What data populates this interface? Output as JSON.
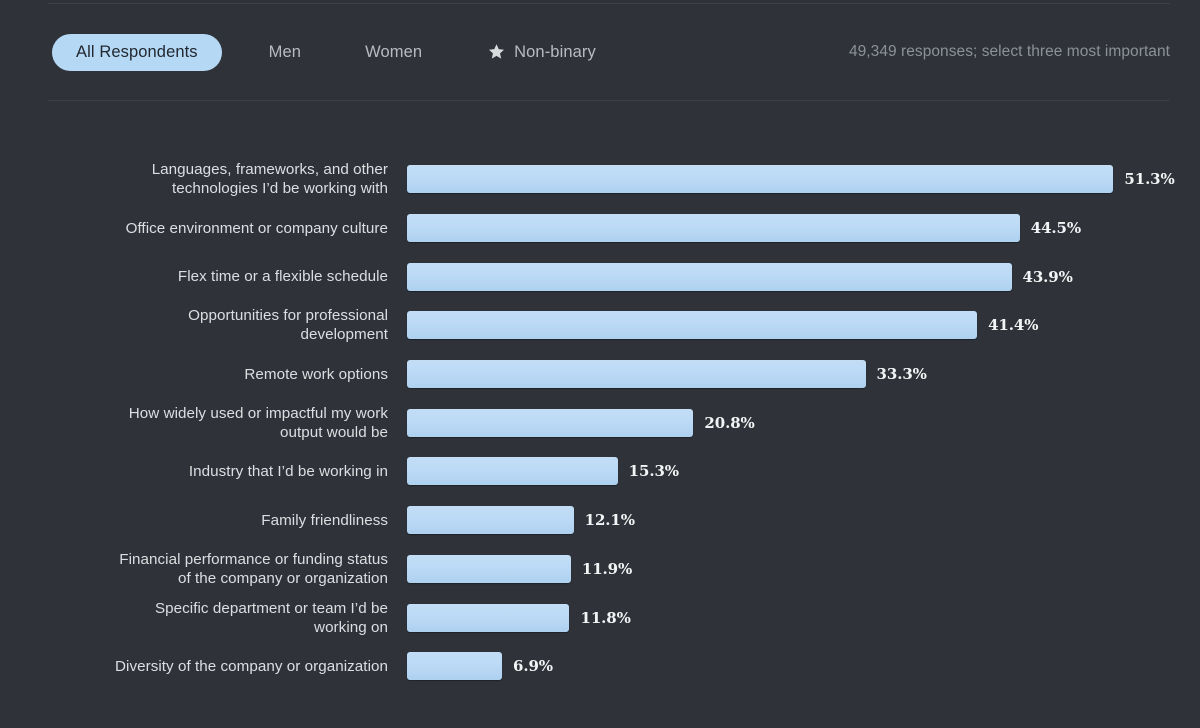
{
  "theme": {
    "background": "#2f3339",
    "bar_color": "#bcdaf6",
    "accent": "#b5d9f4",
    "label_color": "#dcdee1",
    "muted_color": "#8c9198",
    "rule_color": "#3a3f46"
  },
  "header": {
    "tabs": [
      {
        "label": "All Respondents",
        "active": true,
        "icon": null
      },
      {
        "label": "Men",
        "active": false,
        "icon": null
      },
      {
        "label": "Women",
        "active": false,
        "icon": null
      },
      {
        "label": "Non-binary",
        "active": false,
        "icon": "star-icon"
      }
    ],
    "note": "49,349 responses; select three most important"
  },
  "chart_data": {
    "type": "bar",
    "orientation": "horizontal",
    "title": "",
    "subtitle": "",
    "xlabel": "",
    "ylabel": "",
    "xlim": [
      0,
      51.3
    ],
    "grid": false,
    "legend": false,
    "value_suffix": "%",
    "categories": [
      "Languages, frameworks, and other\ntechnologies I’d be working with",
      "Office environment or company culture",
      "Flex time or a flexible schedule",
      "Opportunities for professional\ndevelopment",
      "Remote work options",
      "How widely used or impactful my work\noutput would be",
      "Industry that I’d be working in",
      "Family friendliness",
      "Financial performance or funding status\nof the company or organization",
      "Specific department or team I’d be\nworking on",
      "Diversity of the company or organization"
    ],
    "values": [
      51.3,
      44.5,
      43.9,
      41.4,
      33.3,
      20.8,
      15.3,
      12.1,
      11.9,
      11.8,
      6.9
    ],
    "value_labels": [
      "51.3%",
      "44.5%",
      "43.9%",
      "41.4%",
      "33.3%",
      "20.8%",
      "15.3%",
      "12.1%",
      "11.9%",
      "11.8%",
      "6.9%"
    ]
  }
}
